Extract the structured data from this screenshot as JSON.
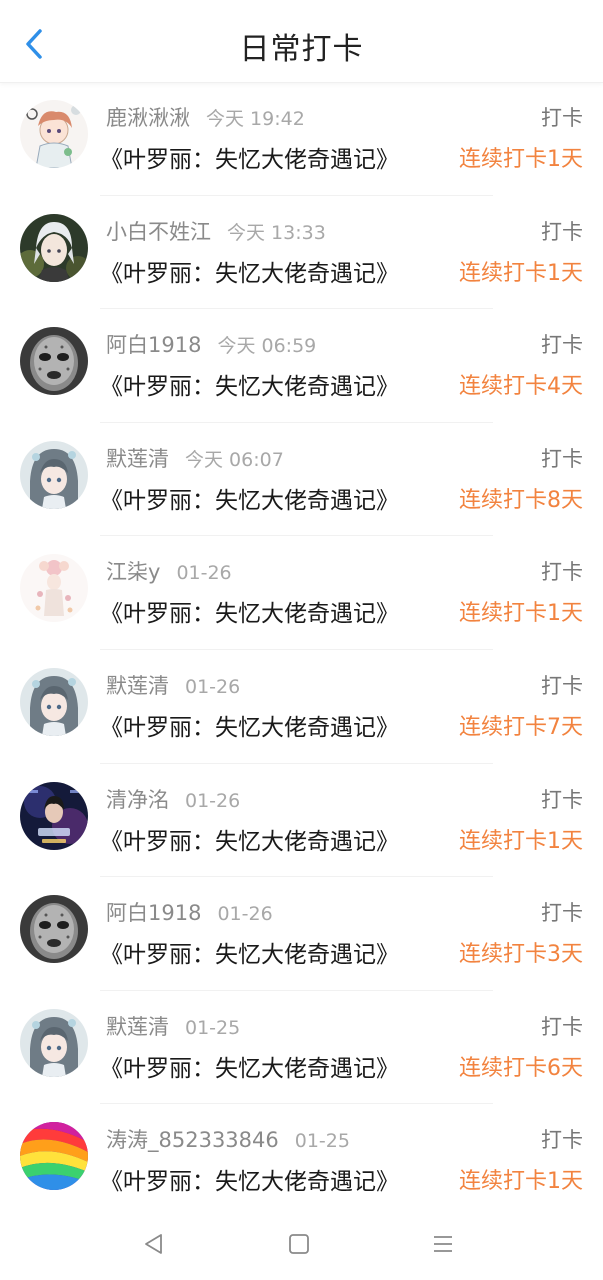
{
  "header": {
    "title": "日常打卡"
  },
  "rows": [
    {
      "user": "鹿湫湫湫",
      "time": "今天 19:42",
      "action": "打卡",
      "book": "《叶罗丽：失忆大佬奇遇记》",
      "streak": "连续打卡1天",
      "avatar_icon": "anime-girl-sketch-avatar"
    },
    {
      "user": "小白不姓江",
      "time": "今天 13:33",
      "action": "打卡",
      "book": "《叶罗丽：失忆大佬奇遇记》",
      "streak": "连续打卡1天",
      "avatar_icon": "white-hair-boy-avatar"
    },
    {
      "user": "阿白1918",
      "time": "今天 06:59",
      "action": "打卡",
      "book": "《叶罗丽：失忆大佬奇遇记》",
      "streak": "连续打卡4天",
      "avatar_icon": "mask-avatar"
    },
    {
      "user": "默莲清",
      "time": "今天 06:07",
      "action": "打卡",
      "book": "《叶罗丽：失忆大佬奇遇记》",
      "streak": "连续打卡8天",
      "avatar_icon": "anime-girl-avatar"
    },
    {
      "user": "江柒y",
      "time": "01-26",
      "action": "打卡",
      "book": "《叶罗丽：失忆大佬奇遇记》",
      "streak": "连续打卡1天",
      "avatar_icon": "flower-girl-avatar"
    },
    {
      "user": "默莲清",
      "time": "01-26",
      "action": "打卡",
      "book": "《叶罗丽：失忆大佬奇遇记》",
      "streak": "连续打卡7天",
      "avatar_icon": "anime-girl-avatar"
    },
    {
      "user": "清净洺",
      "time": "01-26",
      "action": "打卡",
      "book": "《叶罗丽：失忆大佬奇遇记》",
      "streak": "连续打卡1天",
      "avatar_icon": "dark-poster-avatar"
    },
    {
      "user": "阿白1918",
      "time": "01-26",
      "action": "打卡",
      "book": "《叶罗丽：失忆大佬奇遇记》",
      "streak": "连续打卡3天",
      "avatar_icon": "mask-avatar"
    },
    {
      "user": "默莲清",
      "time": "01-25",
      "action": "打卡",
      "book": "《叶罗丽：失忆大佬奇遇记》",
      "streak": "连续打卡6天",
      "avatar_icon": "anime-girl-avatar"
    },
    {
      "user": "涛涛_852333846",
      "time": "01-25",
      "action": "打卡",
      "book": "《叶罗丽：失忆大佬奇遇记》",
      "streak": "连续打卡1天",
      "avatar_icon": "rainbow-swirl-avatar"
    }
  ],
  "colors": {
    "accent_blue": "#2f8fe8",
    "streak_orange": "#f2833f",
    "meta_gray": "#8a8a8a"
  },
  "navbar": {
    "icons": [
      "back-triangle-icon",
      "home-square-icon",
      "menu-lines-icon"
    ]
  }
}
